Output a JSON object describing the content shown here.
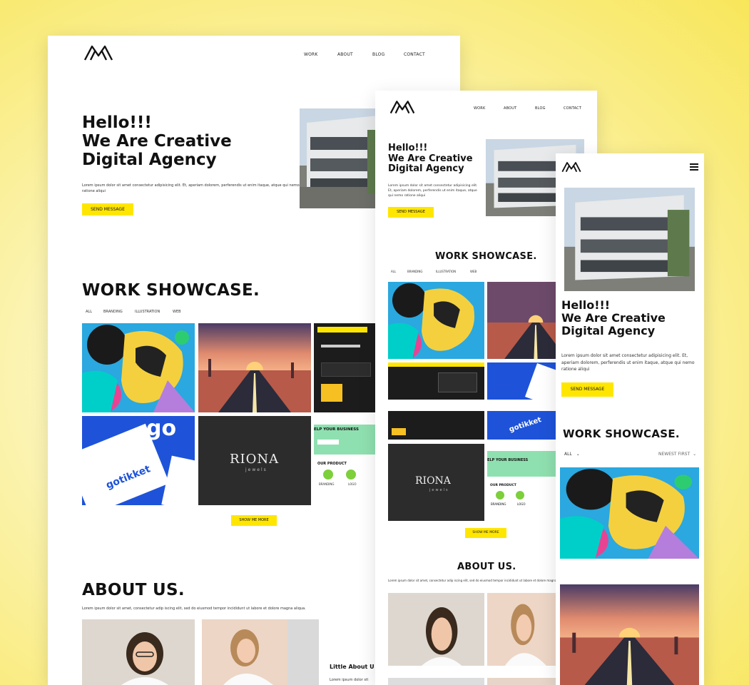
{
  "nav": {
    "work": "WORK",
    "about": "ABOUT",
    "blog": "BLOG",
    "contact": "CONTACT"
  },
  "hero": {
    "line1": "Hello!!!",
    "line2": "We Are Creative",
    "line3": "Digital Agency",
    "text": "Lorem ipsum dolor sit amet consectetur adipisicing elit. Et, aperiam dolorem, perferendis ut enim itaque, atque qui nemo ratione aliqui",
    "button": "SEND MESSAGE"
  },
  "showcase": {
    "title": "WORK SHOWCASE.",
    "filters": [
      "ALL",
      "BRANDING",
      "ILLUSTRATION",
      "WEB"
    ],
    "mobile_filter": "ALL",
    "mobile_sort": "NEWEST FIRST",
    "button": "SHOW ME MORE"
  },
  "tiles": {
    "riona": "RIONA",
    "riona_sub": "jewels",
    "gotikket": "gotikket",
    "go": "go",
    "help": "ELP YOUR BUSINESS",
    "our_product": "OUR PRODUCT",
    "branding": "BRANDING",
    "logo": "LOGO"
  },
  "about": {
    "title": "ABOUT US.",
    "text": "Lorem ipsum dolor sit amet, consectetur adip iscing elit, sed do eiusmod tempor incididunt ut labore et dolore magna aliqua.",
    "little": "Little About U",
    "little_text": "Lorem ipsum dolor sit"
  },
  "colors": {
    "accent": "#ffe600",
    "text": "#111111"
  }
}
